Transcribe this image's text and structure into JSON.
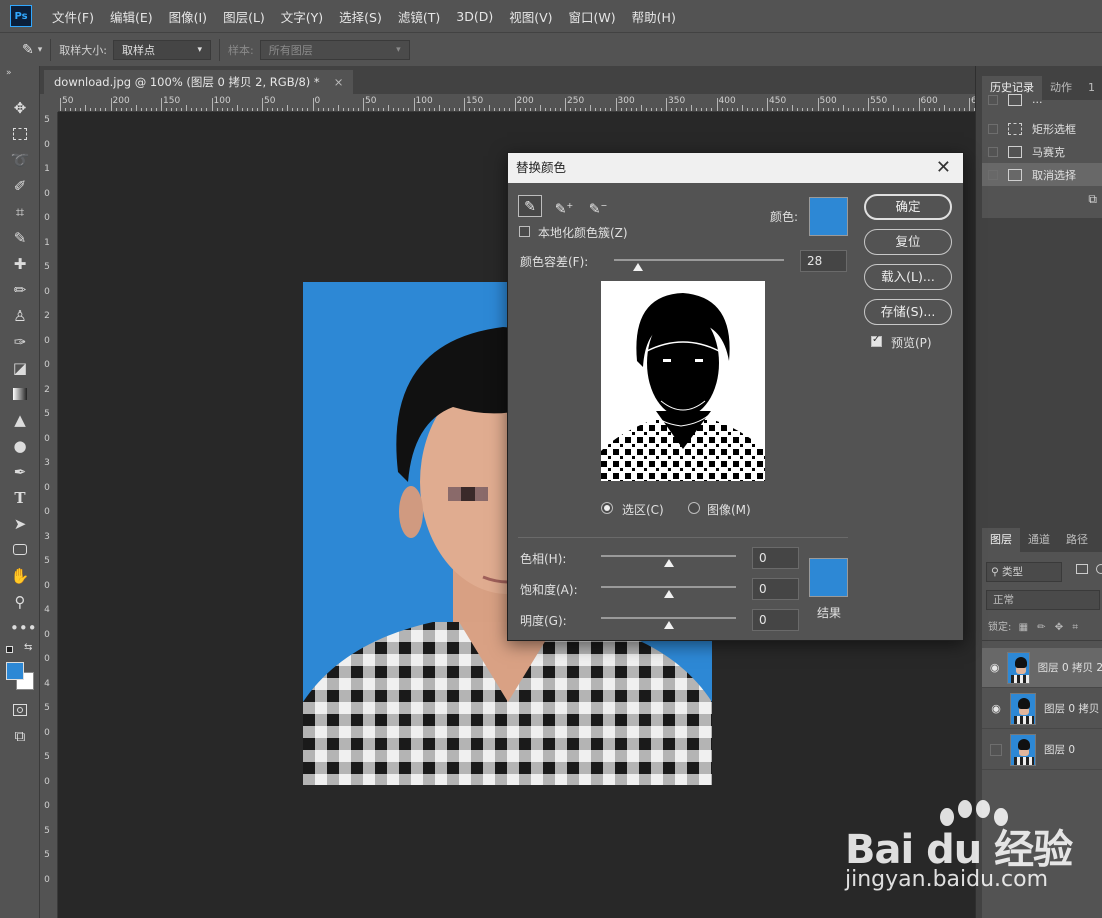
{
  "app": {
    "logo": "Ps"
  },
  "menu": [
    "文件(F)",
    "编辑(E)",
    "图像(I)",
    "图层(L)",
    "文字(Y)",
    "选择(S)",
    "滤镜(T)",
    "3D(D)",
    "视图(V)",
    "窗口(W)",
    "帮助(H)"
  ],
  "options": {
    "sample_size_label": "取样大小:",
    "sample_size_value": "取样点",
    "sample_label": "样本:",
    "sample_value": "所有图层"
  },
  "document": {
    "tab_title": "download.jpg @ 100% (图层 0 拷贝 2, RGB/8) *",
    "close": "×"
  },
  "ruler": {
    "top_labels": [
      "50",
      "200",
      "150",
      "100",
      "50",
      "0",
      "50",
      "100",
      "150",
      "200",
      "250",
      "300",
      "350",
      "400",
      "450",
      "500",
      "550",
      "600",
      "650"
    ],
    "left_labels": [
      "5",
      "0",
      "1",
      "0",
      "0",
      "1",
      "5",
      "0",
      "2",
      "0",
      "0",
      "2",
      "5",
      "0",
      "3",
      "0",
      "0",
      "3",
      "5",
      "0",
      "4",
      "0",
      "0",
      "4",
      "5",
      "0",
      "5",
      "0",
      "0",
      "5",
      "5",
      "0"
    ]
  },
  "history_panel": {
    "tabs": [
      "历史记录",
      "动作",
      "1"
    ],
    "items": [
      {
        "label": "...",
        "partial": true
      },
      {
        "label": "矩形选框"
      },
      {
        "label": "马赛克"
      },
      {
        "label": "取消选择",
        "selected": true
      }
    ]
  },
  "layers_panel": {
    "tabs": [
      "图层",
      "通道",
      "路径"
    ],
    "filter_label": "类型",
    "blend_mode": "正常",
    "lock_label": "锁定:",
    "layers": [
      {
        "name": "图层 0 拷贝 2",
        "visible": true,
        "selected": true
      },
      {
        "name": "图层 0 拷贝",
        "visible": true,
        "selected": false
      },
      {
        "name": "图层 0",
        "visible": false,
        "selected": false
      }
    ]
  },
  "dialog": {
    "title": "替换颜色",
    "close": "✕",
    "localized_label": "本地化颜色簇(Z)",
    "localized_checked": false,
    "color_label": "颜色:",
    "fuzziness_label": "颜色容差(F):",
    "fuzziness_value": "28",
    "fuzziness_fraction": 0.14,
    "buttons": {
      "ok": "确定",
      "reset": "复位",
      "load": "载入(L)...",
      "save": "存储(S)..."
    },
    "preview_label": "预览(P)",
    "preview_checked": true,
    "radio_selection": "选区(C)",
    "radio_image": "图像(M)",
    "hue_label": "色相(H):",
    "hue_value": "0",
    "saturation_label": "饱和度(A):",
    "saturation_value": "0",
    "lightness_label": "明度(G):",
    "lightness_value": "0",
    "result_label": "结果",
    "colors": {
      "sample": "#2d88d5",
      "result": "#2d88d5"
    }
  },
  "colors": {
    "foreground": "#2d88d5",
    "background": "#ffffff",
    "photo_bg": "#2d88d5"
  },
  "watermark": {
    "brand": "Bai du 经验",
    "url": "jingyan.baidu.com"
  }
}
